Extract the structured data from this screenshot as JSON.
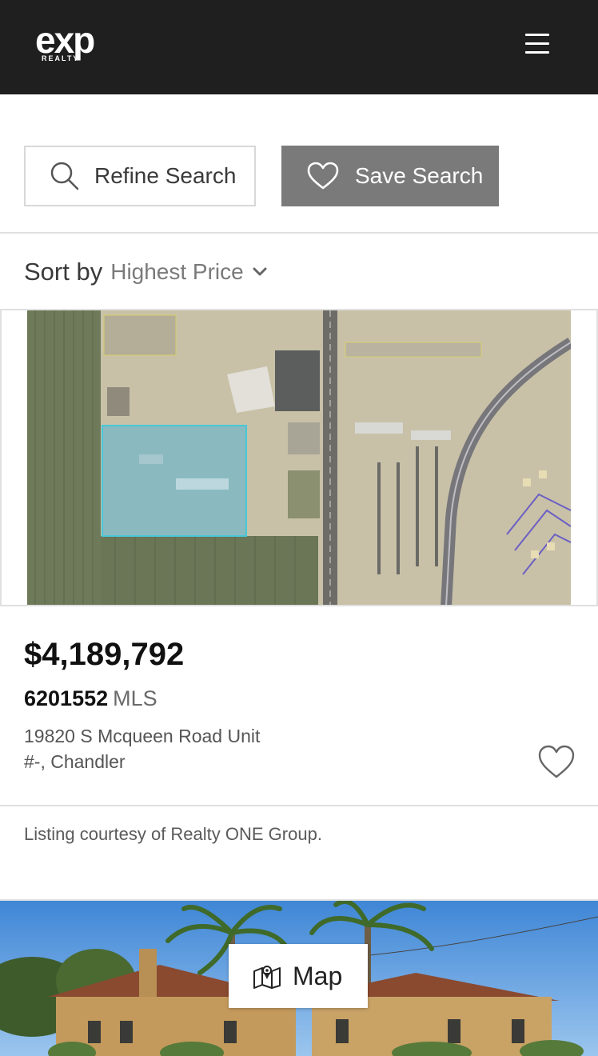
{
  "header": {
    "logo_word": "exp",
    "logo_sub": "REALTY",
    "menu_icon": "hamburger-icon"
  },
  "search": {
    "refine_label": "Refine Search",
    "refine_icon": "search-icon",
    "save_label": "Save Search",
    "save_icon": "heart-icon"
  },
  "sort": {
    "label": "Sort by",
    "value": "Highest Price",
    "icon": "chevron-down-icon"
  },
  "listings": [
    {
      "price": "$4,189,792",
      "mls_number": "6201552",
      "mls_label": "MLS",
      "address_line1": "19820 S Mcqueen Road Unit",
      "address_line2": "#-, Chandler",
      "courtesy": "Listing courtesy of Realty ONE Group.",
      "favorite_icon": "heart-outline-icon"
    }
  ],
  "map_button": {
    "label": "Map",
    "icon": "map-icon"
  },
  "colors": {
    "header_bg": "#1f1f1f",
    "save_button_bg": "#7a7a7a",
    "parcel_highlight": "#7fd0e0"
  }
}
